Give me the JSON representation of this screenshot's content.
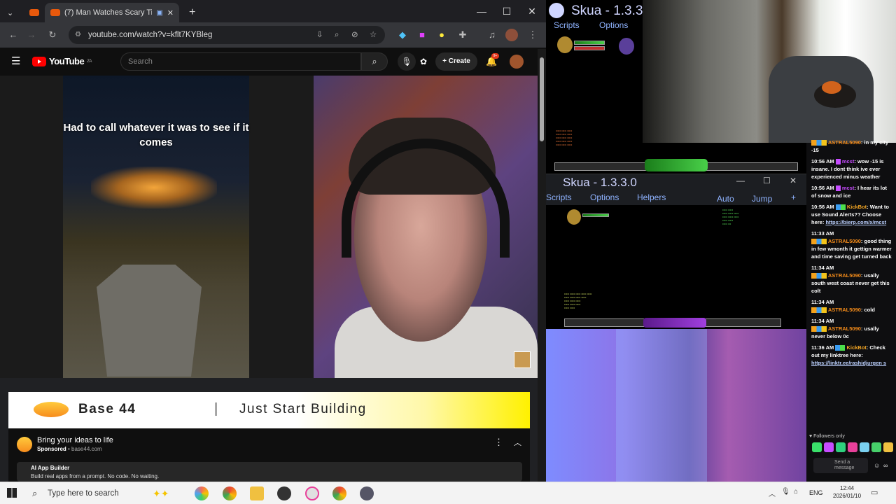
{
  "browser": {
    "tab_title": "(7) Man Watches Scary Tikt",
    "url": "youtube.com/watch?v=kflt7KYBleg"
  },
  "youtube": {
    "logo_text": "YouTube",
    "logo_badge": "ZA",
    "search_placeholder": "Search",
    "create_label": "Create",
    "notification_count": "9+"
  },
  "video": {
    "caption": "Had to call whatever it was to see if it comes"
  },
  "ad": {
    "brand": "Base 44",
    "separator": "|",
    "tagline": "Just Start Building",
    "title": "Bring your ideas to life",
    "sponsored_label": "Sponsored",
    "sponsored_domain": "base44.com",
    "sub_title": "AI App Builder",
    "sub_desc": "Build real apps from a prompt. No code. No waiting."
  },
  "skua_top": {
    "title": "Skua - 1.3.3.",
    "menu": [
      "Scripts",
      "Options"
    ]
  },
  "skua_bottom": {
    "title": "Skua - 1.3.3.0",
    "menu": [
      "Scripts",
      "Options",
      "Helpers"
    ],
    "right_menu": [
      "Auto",
      "Jump",
      "+"
    ]
  },
  "chat": {
    "messages": [
      {
        "time": "",
        "user": "ASTRAL5090",
        "text": "in my city -15"
      },
      {
        "time": "10:56 AM",
        "user": "mcst",
        "text": "wow -15 is insane. I dont think ive ever experienced minus weather"
      },
      {
        "time": "10:56 AM",
        "user": "mcst",
        "text": "I hear its lot of snow and ice"
      },
      {
        "time": "10:56 AM",
        "user": "KickBot",
        "text": "Want to use Sound Alerts?? Choose here:",
        "link": "https://bierp.com/x/mcst"
      },
      {
        "time": "11:33 AM",
        "user": "ASTRAL5090",
        "text": "good thing in few wmonth it gettign warmer and time saving get turned back"
      },
      {
        "time": "11:34 AM",
        "user": "ASTRAL5090",
        "text": "usally south west coast never get this colt"
      },
      {
        "time": "11:34 AM",
        "user": "ASTRAL5090",
        "text": "cold"
      },
      {
        "time": "11:34 AM",
        "user": "ASTRAL5090",
        "text": "usally never below 0c"
      },
      {
        "time": "11:36 AM",
        "user": "KickBot",
        "text": "Check out my linktree here:",
        "link": "https://linktr.ee/rashidjurgen s"
      }
    ],
    "followers_only": "Followers only",
    "send_placeholder": "Send a message"
  },
  "taskbar": {
    "search_placeholder": "Type here to search",
    "language": "ENG",
    "time": "12:44",
    "date": "2026/01/10"
  }
}
